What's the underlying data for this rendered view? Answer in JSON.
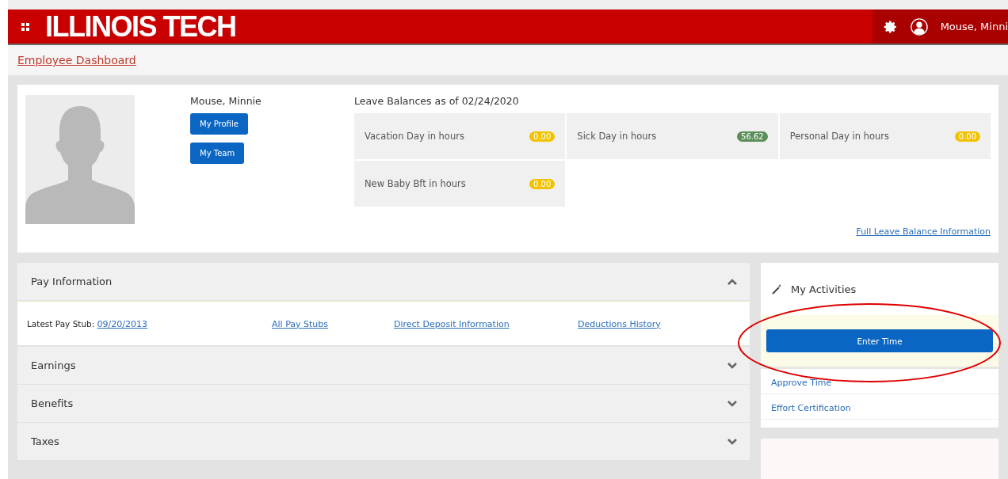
{
  "header": {
    "logo": "ILLINOIS TECH",
    "user_name": "Mouse, Minni"
  },
  "breadcrumb": "Employee Dashboard",
  "profile": {
    "name": "Mouse, Minnie",
    "buttons": [
      "My Profile",
      "My Team"
    ]
  },
  "leave_balances": {
    "title": "Leave Balances as of 02/24/2020",
    "items": [
      {
        "label": "Vacation Day in hours",
        "value": "0.00",
        "color": "#f2c200"
      },
      {
        "label": "Sick Day in hours",
        "value": "56.62",
        "color": "#5a8f5a"
      },
      {
        "label": "Personal Day in hours",
        "value": "0.00",
        "color": "#f2c200"
      },
      {
        "label": "New Baby Bft in hours",
        "value": "0.00",
        "color": "#f2c200"
      }
    ],
    "link": "Full Leave Balance Information"
  },
  "sections": [
    {
      "title": "Pay Information",
      "expanded": true
    },
    {
      "title": "Earnings",
      "expanded": false
    },
    {
      "title": "Benefits",
      "expanded": false
    },
    {
      "title": "Taxes",
      "expanded": false
    }
  ],
  "pay_information": {
    "label": "Latest Pay Stub:",
    "stub_link": "09/20/2013",
    "links": [
      "All Pay Stubs",
      "Direct Deposit Information",
      "Deductions History"
    ]
  },
  "activities": {
    "title": "My Activities",
    "primary": "Enter Time",
    "links": [
      "Approve Time",
      "Effort Certification"
    ],
    "highlighted": true
  }
}
